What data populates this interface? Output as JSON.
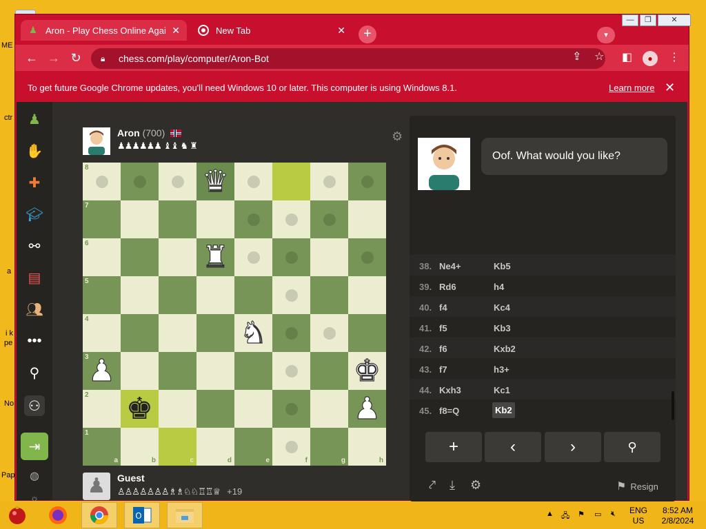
{
  "desktop": {
    "labels": [
      "ME",
      "ctr",
      "a",
      "i k",
      "pe",
      "No",
      "Pap"
    ]
  },
  "browser": {
    "tabs": [
      {
        "title": "Aron - Play Chess Online Against",
        "close": "✕",
        "active": true
      },
      {
        "title": "New Tab",
        "close": "✕",
        "active": false
      }
    ],
    "new_tab": "+",
    "window_controls": {
      "minimize": "—",
      "restore": "❐",
      "close": "✕"
    },
    "url": "chess.com/play/computer/Aron-Bot",
    "infobar": {
      "message": "To get future Google Chrome updates, you'll need Windows 10 or later. This computer is using Windows 8.1.",
      "learn_more": "Learn more",
      "close": "✕"
    }
  },
  "game": {
    "opponent": {
      "name": "Aron",
      "rating": "(700)",
      "flag": "Norway",
      "captured": "♟♟♟♟♟♟ ♝♝ ♞ ♜"
    },
    "player": {
      "name": "Guest",
      "captured": "♙♙♙♙♙♙♙♗♗♘♘♖♖♕",
      "advantage": "+19"
    },
    "board": {
      "ranks": [
        "8",
        "7",
        "6",
        "5",
        "4",
        "3",
        "2",
        "1"
      ],
      "files": [
        "a",
        "b",
        "c",
        "d",
        "e",
        "f",
        "g",
        "h"
      ],
      "pieces": [
        {
          "square": "d8",
          "glyph": "♛",
          "color": "white"
        },
        {
          "square": "d6",
          "glyph": "♜",
          "color": "white"
        },
        {
          "square": "e4",
          "glyph": "♞",
          "color": "white"
        },
        {
          "square": "a3",
          "glyph": "♟",
          "color": "white"
        },
        {
          "square": "h3",
          "glyph": "♚",
          "color": "white"
        },
        {
          "square": "b2",
          "glyph": "♚",
          "color": "black"
        },
        {
          "square": "h2",
          "glyph": "♟",
          "color": "white"
        }
      ],
      "highlights": [
        "f8",
        "b2",
        "c1"
      ],
      "selected": [
        "d8"
      ],
      "move_dots": [
        "a8",
        "b8",
        "c8",
        "e8",
        "g8",
        "h8",
        "e7",
        "f7",
        "g7",
        "e6",
        "f6",
        "h6",
        "f5",
        "f4",
        "g4",
        "f3",
        "f2",
        "f1"
      ]
    },
    "bot_message": "Oof. What would you like?",
    "moves": [
      {
        "num": "38.",
        "white": "Ne4+",
        "black": "Kb5"
      },
      {
        "num": "39.",
        "white": "Rd6",
        "black": "h4"
      },
      {
        "num": "40.",
        "white": "f4",
        "black": "Kc4"
      },
      {
        "num": "41.",
        "white": "f5",
        "black": "Kb3"
      },
      {
        "num": "42.",
        "white": "f6",
        "black": "Kxb2"
      },
      {
        "num": "43.",
        "white": "f7",
        "black": "h3+"
      },
      {
        "num": "44.",
        "white": "Kxh3",
        "black": "Kc1"
      },
      {
        "num": "45.",
        "white": "f8=Q",
        "black": "Kb2"
      }
    ],
    "controls": {
      "add": "+",
      "prev": "‹",
      "next": "›",
      "analysis": "🔍"
    },
    "resign": "Resign"
  },
  "taskbar": {
    "lang": {
      "line1": "ENG",
      "line2": "US"
    },
    "clock": {
      "time": "8:52 AM",
      "date": "2/8/2024"
    }
  }
}
